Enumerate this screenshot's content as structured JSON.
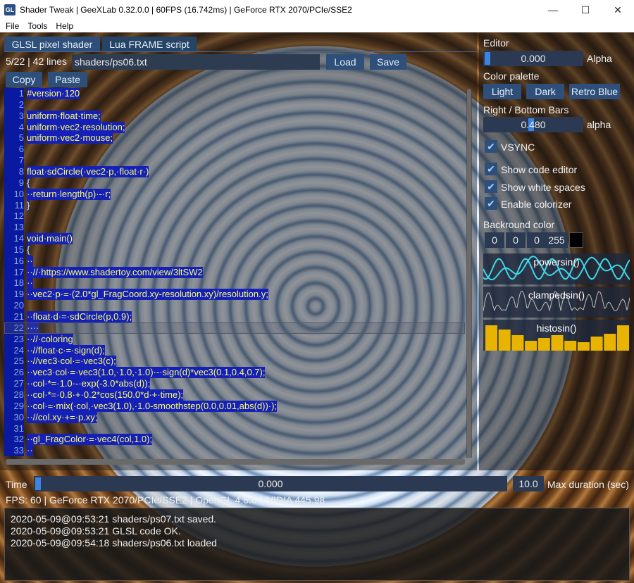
{
  "window": {
    "title": "Shader Tweak | GeeXLab 0.32.0.0 | 60FPS (16.742ms) | GeForce RTX 2070/PCIe/SSE2",
    "icon_label": "GL"
  },
  "menu": [
    "File",
    "Tools",
    "Help"
  ],
  "tabs": [
    "GLSL pixel shader",
    "Lua FRAME script"
  ],
  "file_bar": {
    "position": "5/22 | 42 lines",
    "path": "shaders/ps06.txt",
    "load_label": "Load",
    "save_label": "Save"
  },
  "edit_buttons": {
    "copy_label": "Copy",
    "paste_label": "Paste"
  },
  "code_lines": [
    {
      "n": "1",
      "text": "#version·120"
    },
    {
      "n": "2",
      "text": ""
    },
    {
      "n": "3",
      "text": "uniform·float·time;"
    },
    {
      "n": "4",
      "text": "uniform·vec2·resolution;"
    },
    {
      "n": "5",
      "text": "uniform·vec2·mouse;"
    },
    {
      "n": "6",
      "text": ""
    },
    {
      "n": "7",
      "text": ""
    },
    {
      "n": "8",
      "text": "float·sdCircle(·vec2·p,·float·r·)"
    },
    {
      "n": "9",
      "text": "{"
    },
    {
      "n": "10",
      "text": "··return·length(p)·-·r;"
    },
    {
      "n": "11",
      "text": "}"
    },
    {
      "n": "12",
      "text": ""
    },
    {
      "n": "13",
      "text": ""
    },
    {
      "n": "14",
      "text": "void·main()"
    },
    {
      "n": "15",
      "text": "{"
    },
    {
      "n": "16",
      "text": "··"
    },
    {
      "n": "17",
      "text": "··//·https://www.shadertoy.com/view/3ltSW2"
    },
    {
      "n": "18",
      "text": "··"
    },
    {
      "n": "19",
      "text": "··vec2·p·=·(2.0*gl_FragCoord.xy-resolution.xy)/resolution.y;"
    },
    {
      "n": "20",
      "text": ""
    },
    {
      "n": "21",
      "text": "··float·d·=·sdCircle(p,0.9);"
    },
    {
      "n": "22",
      "text": "····"
    },
    {
      "n": "23",
      "text": "··//·coloring"
    },
    {
      "n": "24",
      "text": "··//float·c·=·sign(d);"
    },
    {
      "n": "25",
      "text": "··//vec3·col·=·vec3(c);"
    },
    {
      "n": "26",
      "text": "··vec3·col·=·vec3(1.0,·1.0,·1.0)·-·sign(d)*vec3(0.1,0.4,0.7);"
    },
    {
      "n": "27",
      "text": "··col·*=·1.0·-·exp(-3.0*abs(d));"
    },
    {
      "n": "28",
      "text": "··col·*=·0.8·+·0.2*cos(150.0*d·+·time);"
    },
    {
      "n": "29",
      "text": "··col·=·mix(·col,·vec3(1.0),·1.0-smoothstep(0.0,0.01,abs(d))·);"
    },
    {
      "n": "30",
      "text": "··//col.xy·+=·p.xy;"
    },
    {
      "n": "31",
      "text": ""
    },
    {
      "n": "32",
      "text": "··gl_FragColor·=·vec4(col,1.0);"
    },
    {
      "n": "33",
      "text": "··"
    }
  ],
  "right_panel": {
    "editor_label": "Editor",
    "editor_alpha_value": "0.000",
    "editor_alpha_label": "Alpha",
    "editor_alpha_fraction": 0.0,
    "palette_label": "Color palette",
    "palette_buttons": [
      "Light",
      "Dark",
      "Retro Blue"
    ],
    "bars_label": "Right / Bottom Bars",
    "bars_alpha_value": "0.480",
    "bars_alpha_label": "alpha",
    "bars_alpha_fraction": 0.48,
    "vsync_label": "VSYNC",
    "options": [
      "Show code editor",
      "Show white spaces",
      "Enable colorizer"
    ],
    "bg_label": "Backround color",
    "bg_values": [
      "0",
      "0",
      "0",
      "255"
    ],
    "plots": [
      "powersin()",
      "clampedsin()",
      "histosin()"
    ]
  },
  "time_bar": {
    "label": "Time",
    "value": "0.000",
    "max_value": "10.0",
    "max_label": "Max duration (sec)"
  },
  "status": "FPS: 60 | GeForce RTX 2070/PCIe/SSE2 | OpenGL 4.6.0 NVIDIA 445.98",
  "log": [
    "2020-05-09@09:53:21 shaders/ps07.txt saved.",
    "2020-05-09@09:53:21 GLSL code OK.",
    "2020-05-09@09:54:18 shaders/ps06.txt loaded"
  ],
  "colors": {
    "accent": "#2d4f7a",
    "code_text": "#ffff66",
    "code_bg": "#1420b8",
    "plot_cyan": "#3fd8e8",
    "plot_hist": "#e8b400"
  }
}
